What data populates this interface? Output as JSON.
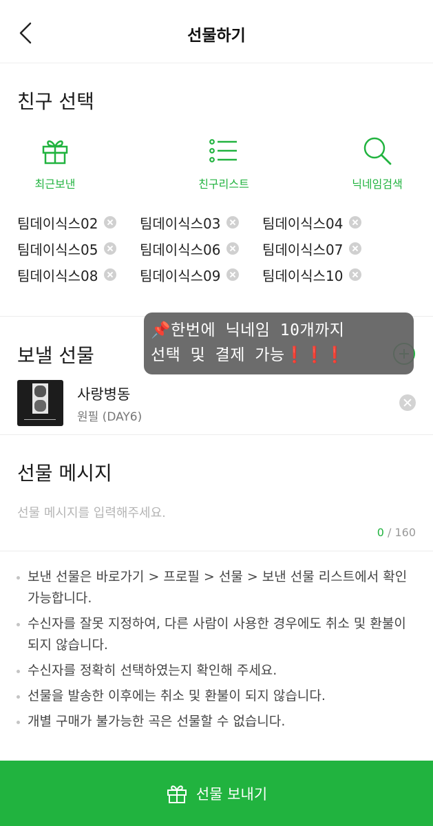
{
  "header": {
    "title": "선물하기"
  },
  "friends": {
    "section_title": "친구 선택",
    "actions": [
      {
        "icon": "gift-icon",
        "label": "최근보낸"
      },
      {
        "icon": "list-icon",
        "label": "친구리스트"
      },
      {
        "icon": "search-icon",
        "label": "닉네임검색"
      }
    ],
    "selected": [
      "팀데이식스02",
      "팀데이식스03",
      "팀데이식스04",
      "팀데이식스05",
      "팀데이식스06",
      "팀데이식스07",
      "팀데이식스08",
      "팀데이식스09",
      "팀데이식스10"
    ]
  },
  "overlay_note": {
    "line1": "📌한번에 닉네임 10개까지",
    "line2_text": "선택 및 결제 가능",
    "line2_marks": "❗❗❗"
  },
  "gift": {
    "section_title": "보낼 선물",
    "song_title": "사랑병동",
    "artist": "원필 (DAY6)"
  },
  "message": {
    "section_title": "선물 메시지",
    "placeholder": "선물 메시지를 입력해주세요.",
    "value": "",
    "count_current": "0",
    "count_max": " / 160"
  },
  "notices": [
    "보낸 선물은 바로가기 > 프로필 > 선물 > 보낸 선물 리스트에서 확인 가능합니다.",
    "수신자를 잘못 지정하여, 다른 사람이 사용한 경우에도 취소 및 환불이 되지 않습니다.",
    "수신자를 정확히 선택하였는지 확인해 주세요.",
    "선물을 발송한 이후에는 취소 및 환불이 되지 않습니다.",
    "개별 구매가 불가능한 곡은 선물할 수 없습니다."
  ],
  "send_button": {
    "label": "선물 보내기"
  },
  "colors": {
    "accent": "#21b33f",
    "overlay": "#606060"
  }
}
